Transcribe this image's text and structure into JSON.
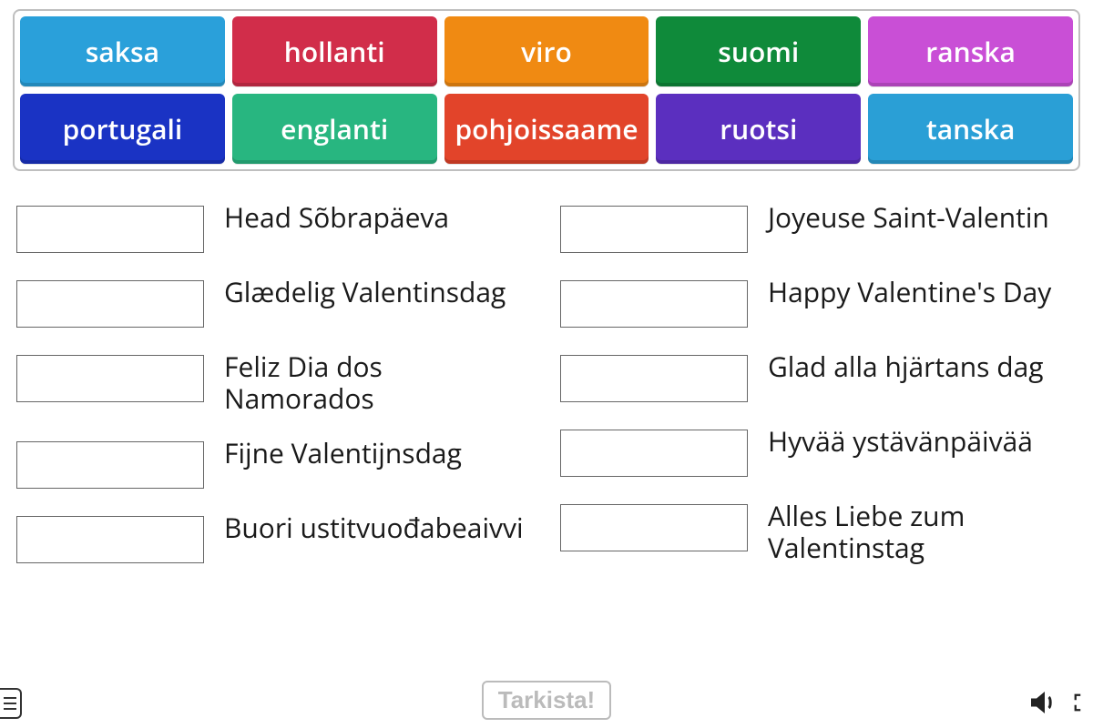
{
  "tiles": [
    {
      "label": "saksa",
      "color": "#2aa0da"
    },
    {
      "label": "hollanti",
      "color": "#d12d4a"
    },
    {
      "label": "viro",
      "color": "#f08a12"
    },
    {
      "label": "suomi",
      "color": "#0f8a3a"
    },
    {
      "label": "ranska",
      "color": "#c94fd6"
    },
    {
      "label": "portugali",
      "color": "#1a33c4"
    },
    {
      "label": "englanti",
      "color": "#28b680"
    },
    {
      "label": "pohjoissaame",
      "color": "#e2442a"
    },
    {
      "label": "ruotsi",
      "color": "#5b2fbf"
    },
    {
      "label": "tanska",
      "color": "#2a9fd6"
    }
  ],
  "left_phrases": [
    "Head Sõbrapäeva",
    "Glædelig Valentinsdag",
    "Feliz Dia dos Namorados",
    "Fijne Valentijnsdag",
    "Buori ustitvuođabeaivvi"
  ],
  "right_phrases": [
    "Joyeuse Saint-Valentin",
    "Happy Valentine's Day",
    "Glad alla hjärtans dag",
    "Hyvää ystävänpäivää",
    "Alles Liebe zum Valentinstag"
  ],
  "check_label": "Tarkista!"
}
